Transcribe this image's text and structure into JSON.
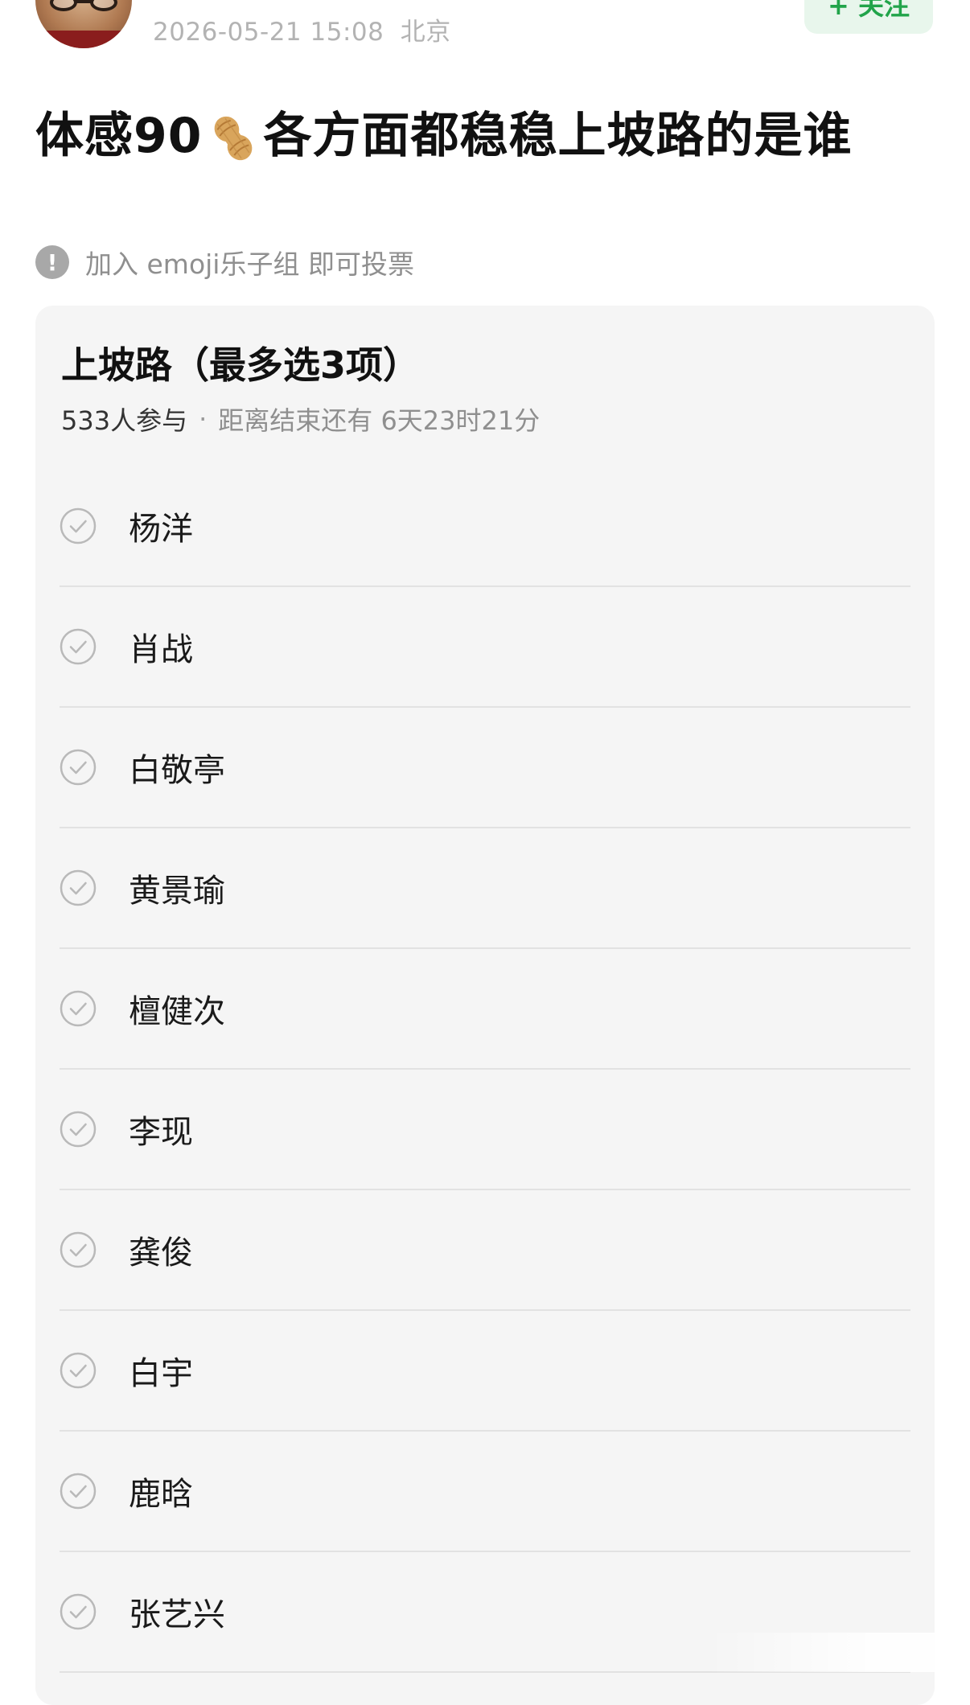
{
  "header": {
    "timestamp": "2026-05-21 15:08",
    "location": "北京",
    "follow_label": "+ 关注"
  },
  "post": {
    "title_before": "体感90",
    "title_emoji": "peanut-icon",
    "title_after": "各方面都稳稳上坡路的是谁"
  },
  "notice": {
    "icon": "exclamation-icon",
    "text": "加入 emoji乐子组 即可投票"
  },
  "poll": {
    "title": "上坡路（最多选3项）",
    "participants": "533人参与",
    "separator": "·",
    "remaining": "距离结束还有 6天23时21分",
    "options": [
      {
        "label": "杨洋"
      },
      {
        "label": "肖战"
      },
      {
        "label": "白敬亭"
      },
      {
        "label": "黄景瑜"
      },
      {
        "label": "檀健次"
      },
      {
        "label": "李现"
      },
      {
        "label": "龚俊"
      },
      {
        "label": "白宇"
      },
      {
        "label": "鹿晗"
      },
      {
        "label": "张艺兴"
      }
    ]
  },
  "colors": {
    "accent_green": "#21a44a",
    "card_background": "#f5f5f5",
    "muted_text": "#8f8f8f"
  }
}
